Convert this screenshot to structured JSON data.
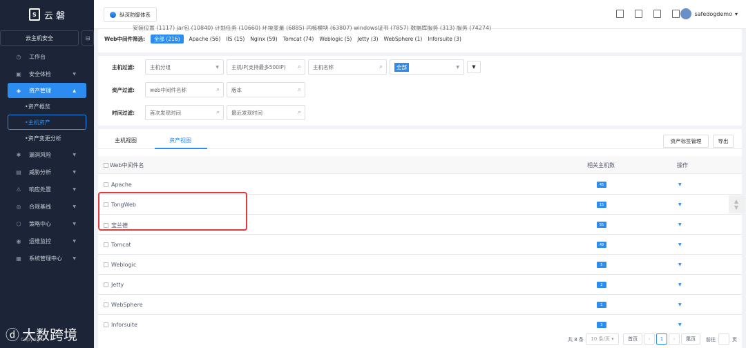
{
  "sidebar": {
    "logo_text": "云 磐",
    "cloud_label": "云主机安全",
    "nav": [
      {
        "label": "工作台",
        "icon": "clock-icon"
      },
      {
        "label": "安全体检",
        "icon": "checkup-icon"
      },
      {
        "label": "资产管理",
        "icon": "layers-icon"
      },
      {
        "label": "资产概览",
        "sub": true
      },
      {
        "label": "主机资产",
        "sub": true,
        "selected": true
      },
      {
        "label": "资产变更分析",
        "sub": true
      },
      {
        "label": "漏洞风险",
        "icon": "bug-icon"
      },
      {
        "label": "威胁分析",
        "icon": "threat-icon"
      },
      {
        "label": "响应处置",
        "icon": "response-icon"
      },
      {
        "label": "合规基线",
        "icon": "baseline-icon"
      },
      {
        "label": "策略中心",
        "icon": "policy-icon"
      },
      {
        "label": "运维监控",
        "icon": "monitor-icon"
      },
      {
        "label": "系统管理中心",
        "icon": "settings-icon"
      }
    ],
    "watermark": "大数跨境",
    "watermark_copy": "Copyright"
  },
  "topbar": {
    "system_tab": "纵深防御体系",
    "username": "safedogdemo"
  },
  "web_filter": {
    "clipped_line": "安装位置 (1117)    jar包 (10840)    计划任务 (10660)    环境变量 (6885)    内核模块 (63807)    windows证书 (7857)    数据库服务 (313)    服务 (74274)",
    "label": "Web中间件筛选:",
    "items": [
      "全部 (216)",
      "Apache (56)",
      "IIS (15)",
      "Nginx (59)",
      "Tomcat (74)",
      "Weblogic (5)",
      "Jetty (3)",
      "WebSphere (1)",
      "Inforsuite (3)"
    ]
  },
  "filters": {
    "host_label": "主机过滤:",
    "host_group_placeholder": "主机分组",
    "host_ip_placeholder": "主机IP(支持最多500IP)",
    "host_name_placeholder": "主机名称",
    "status_value": "全部",
    "asset_label": "资产过滤:",
    "web_name_placeholder": "web中间件名称",
    "version_placeholder": "版本",
    "time_label": "时间过滤:",
    "first_found_placeholder": "首次发现时间",
    "last_found_placeholder": "最近发现时间"
  },
  "tabs": {
    "host_view": "主机视图",
    "asset_view": "资产视图",
    "tag_manage": "资产标签管理",
    "export": "导出"
  },
  "table": {
    "headers": {
      "name": "Web中间件名",
      "hosts": "相关主机数",
      "op": "操作"
    },
    "rows": [
      {
        "name": "Apache",
        "hosts": "45"
      },
      {
        "name": "TongWeb",
        "hosts": "15"
      },
      {
        "name": "宝兰德",
        "hosts": "55"
      },
      {
        "name": "Tomcat",
        "hosts": "49"
      },
      {
        "name": "Weblogic",
        "hosts": "5"
      },
      {
        "name": "Jetty",
        "hosts": "2"
      },
      {
        "name": "WebSphere",
        "hosts": "1"
      },
      {
        "name": "Inforsuite",
        "hosts": "3"
      }
    ]
  },
  "pager": {
    "total": "共 8 条",
    "page_size": "10 条/页",
    "first": "首页",
    "prev": "‹",
    "current": "1",
    "next": "›",
    "last": "尾页",
    "goto": "前往",
    "page_unit": "页"
  }
}
